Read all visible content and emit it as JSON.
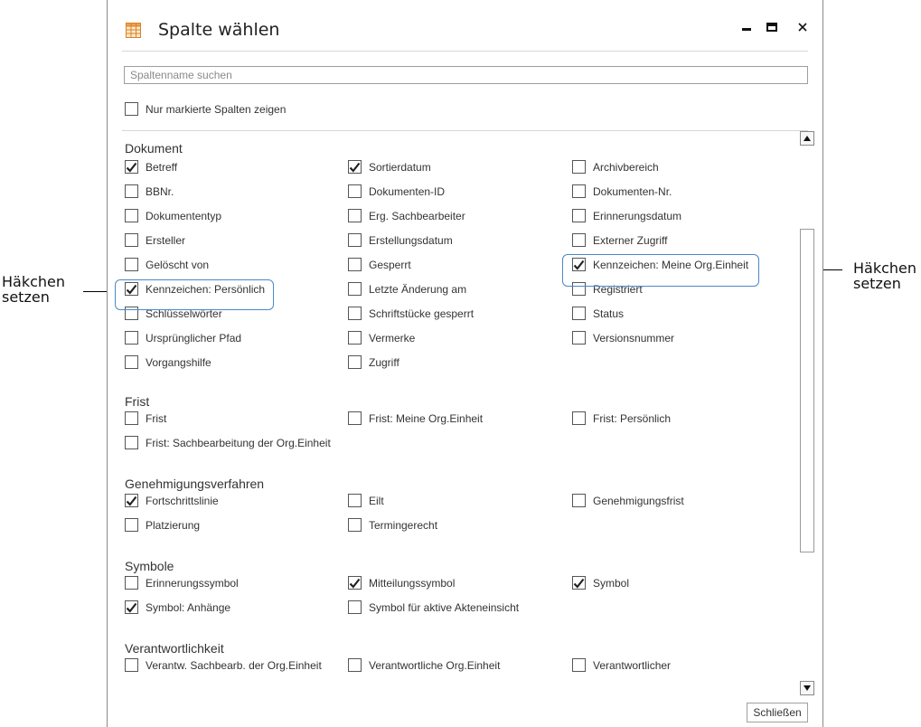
{
  "annotations": {
    "left": {
      "line1": "Häkchen",
      "line2": "setzen"
    },
    "right": {
      "line1": "Häkchen",
      "line2": "setzen"
    }
  },
  "window": {
    "title": "Spalte wählen",
    "minimize": "minimize-icon",
    "maximize": "maximize-icon",
    "close": "close-icon"
  },
  "search": {
    "placeholder": "Spaltenname suchen",
    "value": ""
  },
  "only_marked": {
    "label": "Nur markierte Spalten zeigen",
    "checked": false
  },
  "sections": {
    "dokument": {
      "title": "Dokument",
      "items": [
        {
          "label": "Betreff",
          "checked": true
        },
        {
          "label": "Sortierdatum",
          "checked": true
        },
        {
          "label": "Archivbereich",
          "checked": false
        },
        {
          "label": "BBNr.",
          "checked": false
        },
        {
          "label": "Dokumenten-ID",
          "checked": false
        },
        {
          "label": "Dokumenten-Nr.",
          "checked": false
        },
        {
          "label": "Dokumententyp",
          "checked": false
        },
        {
          "label": "Erg. Sachbearbeiter",
          "checked": false
        },
        {
          "label": "Erinnerungsdatum",
          "checked": false
        },
        {
          "label": "Ersteller",
          "checked": false
        },
        {
          "label": "Erstellungsdatum",
          "checked": false
        },
        {
          "label": "Externer Zugriff",
          "checked": false
        },
        {
          "label": "Gelöscht von",
          "checked": false
        },
        {
          "label": "Gesperrt",
          "checked": false
        },
        {
          "label": "Kennzeichen: Meine Org.Einheit",
          "checked": true
        },
        {
          "label": "Kennzeichen: Persönlich",
          "checked": true
        },
        {
          "label": "Letzte Änderung am",
          "checked": false
        },
        {
          "label": "Registriert",
          "checked": false
        },
        {
          "label": "Schlüsselwörter",
          "checked": false
        },
        {
          "label": "Schriftstücke gesperrt",
          "checked": false
        },
        {
          "label": "Status",
          "checked": false
        },
        {
          "label": "Ursprünglicher Pfad",
          "checked": false
        },
        {
          "label": "Vermerke",
          "checked": false
        },
        {
          "label": "Versionsnummer",
          "checked": false
        },
        {
          "label": "Vorgangshilfe",
          "checked": false
        },
        {
          "label": "Zugriff",
          "checked": false
        }
      ]
    },
    "frist": {
      "title": "Frist",
      "items": [
        {
          "label": "Frist",
          "checked": false
        },
        {
          "label": "Frist: Meine Org.Einheit",
          "checked": false
        },
        {
          "label": "Frist: Persönlich",
          "checked": false
        },
        {
          "label": "Frist: Sachbearbeitung der Org.Einheit",
          "checked": false
        }
      ]
    },
    "genehmigung": {
      "title": "Genehmigungsverfahren",
      "items": [
        {
          "label": "Fortschrittslinie",
          "checked": true
        },
        {
          "label": "Eilt",
          "checked": false
        },
        {
          "label": "Genehmigungsfrist",
          "checked": false
        },
        {
          "label": "Platzierung",
          "checked": false
        },
        {
          "label": "Termingerecht",
          "checked": false
        }
      ]
    },
    "symbole": {
      "title": "Symbole",
      "items": [
        {
          "label": "Erinnerungssymbol",
          "checked": false
        },
        {
          "label": "Mitteilungssymbol",
          "checked": true
        },
        {
          "label": "Symbol",
          "checked": true
        },
        {
          "label": "Symbol: Anhänge",
          "checked": true
        },
        {
          "label": "Symbol für aktive Akteneinsicht",
          "checked": false
        }
      ]
    },
    "verantwortlichkeit": {
      "title": "Verantwortlichkeit",
      "items": [
        {
          "label": "Verantw. Sachbearb. der Org.Einheit",
          "checked": false
        },
        {
          "label": "Verantwortliche Org.Einheit",
          "checked": false
        },
        {
          "label": "Verantwortlicher",
          "checked": false
        }
      ]
    }
  },
  "footer": {
    "close_label": "Schließen"
  },
  "colors": {
    "highlight": "#4a89c8",
    "check": "#222222"
  }
}
